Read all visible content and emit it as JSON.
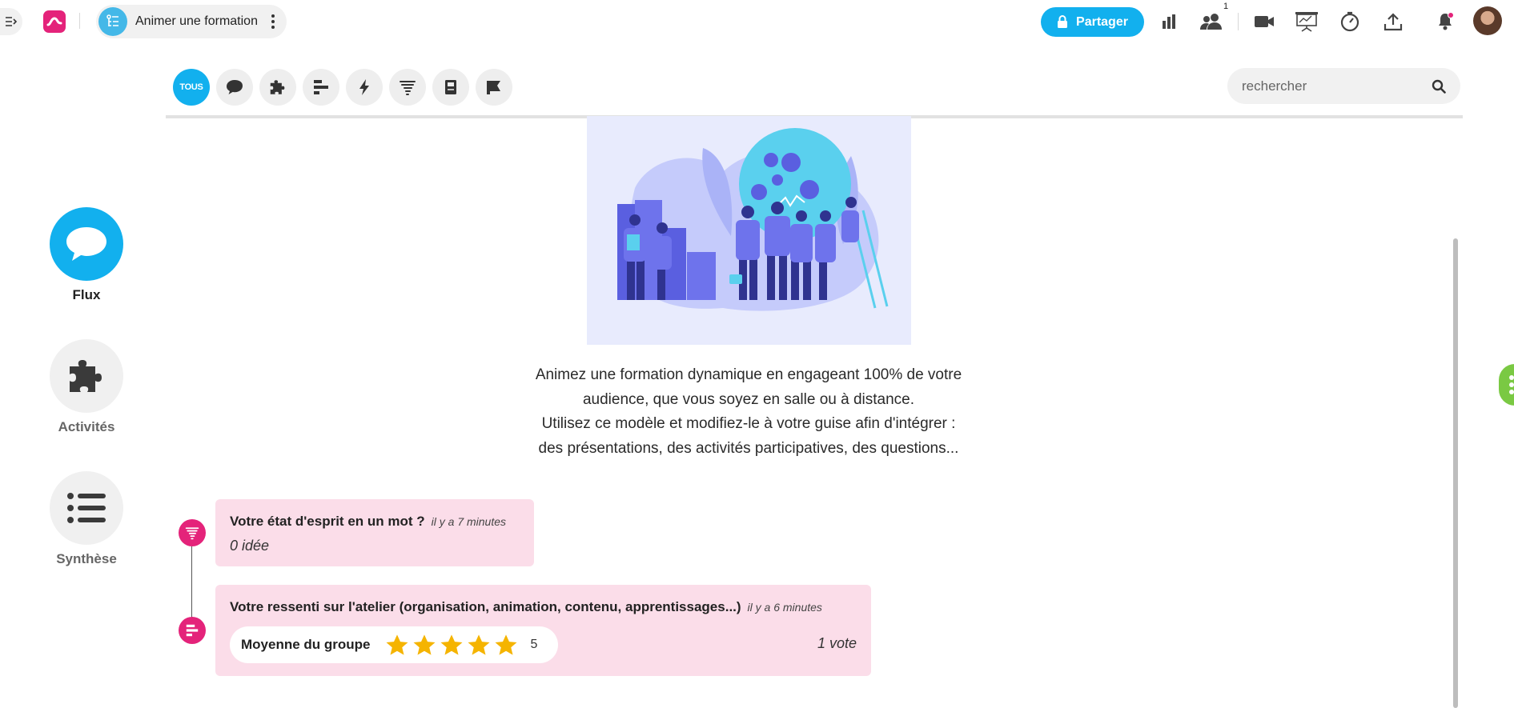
{
  "app": {
    "title": "Animer une formation",
    "share_label": "Partager",
    "participants_badge": "1",
    "colors": {
      "accent": "#12b0ee",
      "brand": "#e4237a",
      "card": "#fbdde9",
      "side_handle": "#7ac943"
    }
  },
  "leftnav": [
    {
      "label": "Flux",
      "icon": "chat-bubble-icon",
      "active": true
    },
    {
      "label": "Activités",
      "icon": "puzzle-icon",
      "active": false
    },
    {
      "label": "Synthèse",
      "icon": "list-icon",
      "active": false
    }
  ],
  "filters": {
    "all_label": "TOUS",
    "icons": [
      "comment-icon",
      "puzzle-icon",
      "bar-chart-icon",
      "lightning-icon",
      "tornado-icon",
      "book-icon",
      "flag-icon"
    ]
  },
  "search": {
    "placeholder": "rechercher",
    "value": ""
  },
  "hero": {
    "line1": "Animez une formation dynamique en engageant 100% de votre",
    "line2": "audience, que vous soyez en salle ou à distance.",
    "line3": "Utilisez ce modèle et modifiez-le à votre guise afin d'intégrer :",
    "line4": "des présentations, des activités participatives, des questions..."
  },
  "feed": [
    {
      "title": "Votre état d'esprit en un mot ?",
      "time": "il y a 7 minutes",
      "subtitle": "0 idée",
      "icon": "tornado-icon"
    },
    {
      "title": "Votre ressenti sur l'atelier (organisation, animation, contenu, apprentissages...)",
      "time": "il y a 6 minutes",
      "rating_label": "Moyenne du groupe",
      "rating_value": "5",
      "rating_stars": 5,
      "votes": "1 vote",
      "icon": "rating-list-icon"
    }
  ]
}
